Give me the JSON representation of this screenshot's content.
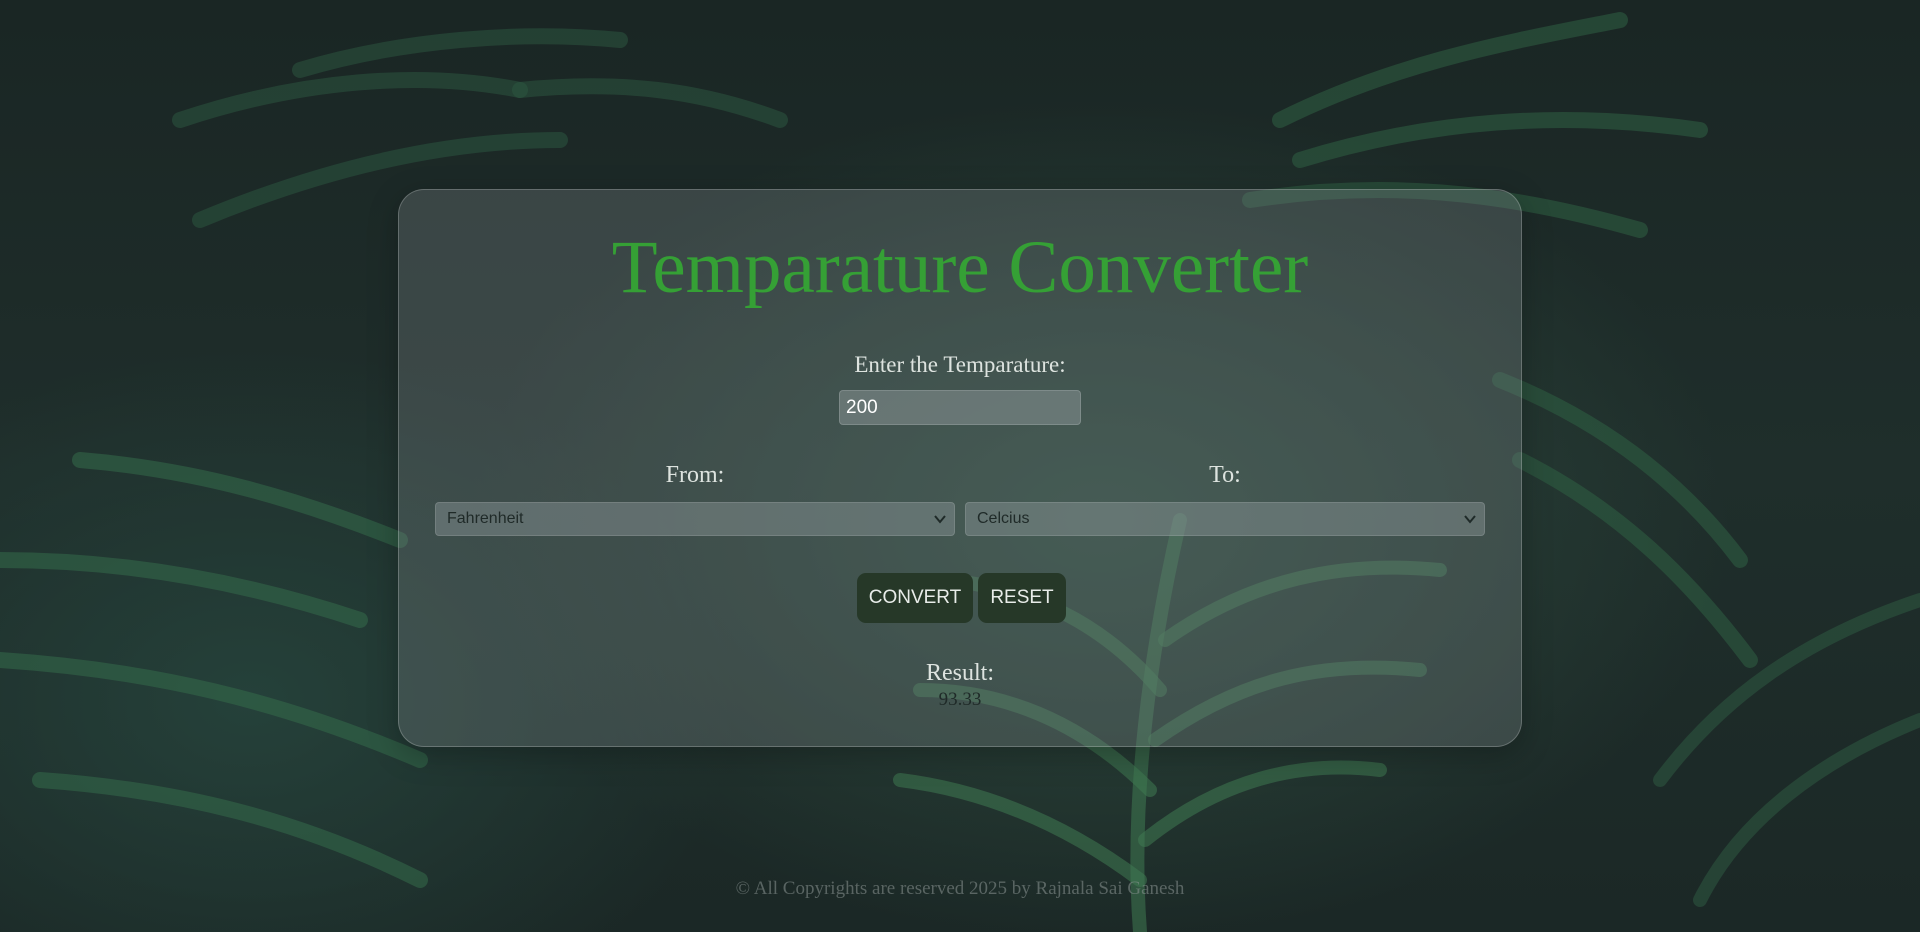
{
  "app": {
    "title": "Temparature Converter"
  },
  "input": {
    "label": "Enter the Temparature:",
    "value": "200"
  },
  "from": {
    "label": "From:",
    "selected": "Fahrenheit"
  },
  "to": {
    "label": "To:",
    "selected": "Celcius"
  },
  "buttons": {
    "convert": "CONVERT",
    "reset": "RESET"
  },
  "result": {
    "label": "Result:",
    "value": "93.33"
  },
  "footer": {
    "text": "© All Copyrights are reserved 2025 by Rajnala Sai Ganesh"
  },
  "colors": {
    "title": "#35a035",
    "button_bg": "#263828"
  }
}
